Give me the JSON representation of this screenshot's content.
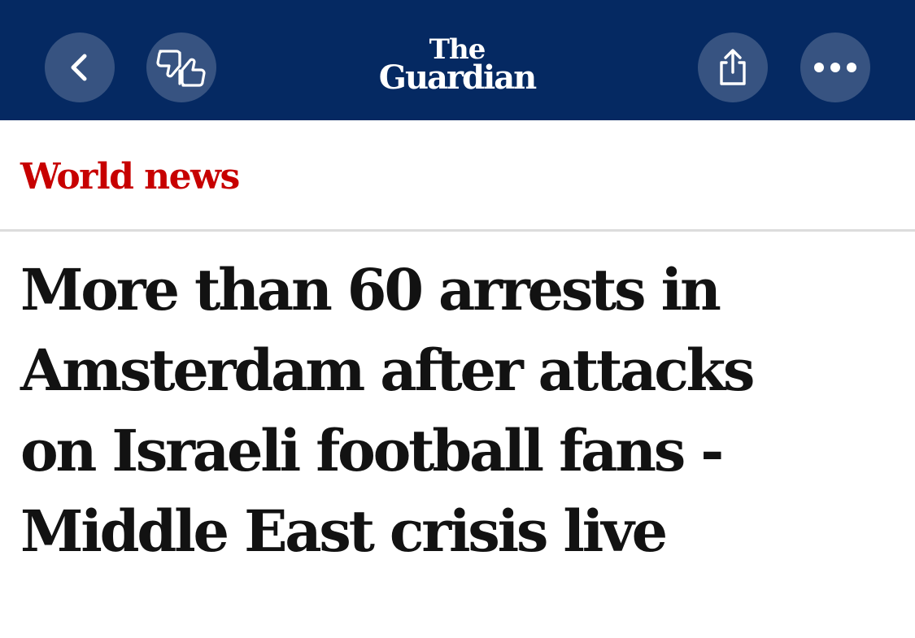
{
  "header": {
    "logo_the": "The",
    "logo_guardian": "Guardian",
    "background_color": "#052962",
    "icons": {
      "back": "chevron-left-icon",
      "feedback": "thumbs-up-down-icon",
      "share": "share-icon",
      "more": "more-horizontal-icon"
    }
  },
  "article": {
    "section": "World news",
    "section_color": "#c70000",
    "headline_lines": [
      "More than 60 arrests in",
      "Amsterdam after attacks",
      "on Israeli football fans -",
      "Middle East crisis live"
    ]
  }
}
